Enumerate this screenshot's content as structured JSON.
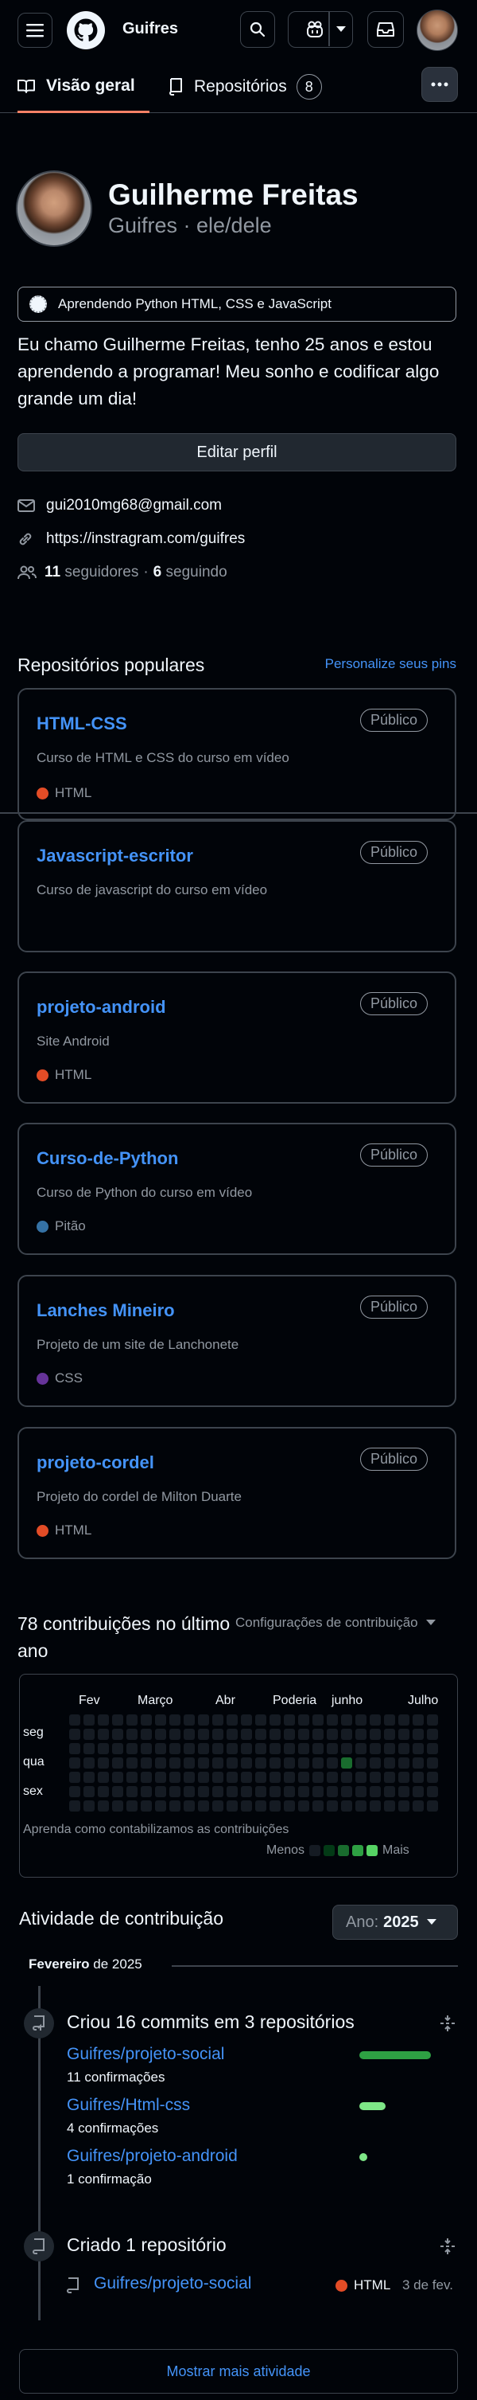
{
  "header": {
    "username": "Guifres"
  },
  "tabs": [
    {
      "label": "Visão geral"
    },
    {
      "label": "Repositórios",
      "count": "8"
    }
  ],
  "profile": {
    "full_name": "Guilherme Freitas",
    "login_line": "Guifres · ele/dele",
    "status": "Aprendendo Python HTML, CSS e JavaScript",
    "bio": "Eu chamo Guilherme Freitas, tenho 25 anos e estou aprendendo a programar! Meu sonho e codificar algo grande um dia!",
    "edit_button": "Editar perfil",
    "email": "gui2010mg68@gmail.com",
    "website": "https://instragram.com/guifres",
    "followers_count": "11",
    "followers_label": "seguidores",
    "separator": "·",
    "following_count": "6",
    "following_label": "seguindo"
  },
  "popular": {
    "title": "Repositórios populares",
    "customize_link": "Personalize seus pins",
    "repos": [
      {
        "name": "HTML-CSS",
        "visibility": "Público",
        "description": "Curso de HTML e CSS do curso em vídeo",
        "language": "HTML",
        "lang_color": "#e34c26"
      },
      {
        "name": "Javascript-escritor",
        "visibility": "Público",
        "description": "Curso de javascript do curso em vídeo",
        "language": "",
        "lang_color": ""
      },
      {
        "name": "projeto-android",
        "visibility": "Público",
        "description": "Site Android",
        "language": "HTML",
        "lang_color": "#e34c26"
      },
      {
        "name": "Curso-de-Python",
        "visibility": "Público",
        "description": "Curso de Python do curso em vídeo",
        "language": "Pitão",
        "lang_color": "#3572a5"
      },
      {
        "name": "Lanches Mineiro",
        "visibility": "Público",
        "description": "Projeto de um site de Lanchonete",
        "language": "CSS",
        "lang_color": "#663399"
      },
      {
        "name": "projeto-cordel",
        "visibility": "Público",
        "description": "Projeto do cordel de Milton Duarte",
        "language": "HTML",
        "lang_color": "#e34c26"
      }
    ]
  },
  "contributions": {
    "title": "78 contribuições no último ano",
    "settings": "Configurações de contribuição",
    "months": [
      "Fev",
      "Março",
      "Abr",
      "Poderia",
      "junho",
      "Julho"
    ],
    "days": [
      "seg",
      "qua",
      "sex"
    ],
    "learn": "Aprenda como contabilizamos as contribuições",
    "less": "Menos",
    "more": "Mais",
    "legend_colors": [
      "#151b23",
      "#033a16",
      "#196c2e",
      "#2ea043",
      "#56d364"
    ]
  },
  "activity": {
    "title": "Atividade de contribuição",
    "year_prefix": "Ano:",
    "year": "2025",
    "month_label": "Fevereiro",
    "month_year": "de 2025",
    "commits_title": "Criou 16 commits em 3 repositórios",
    "commit_repos": [
      {
        "name": "Guifres/projeto-social",
        "count": "11 confirmações",
        "share": 0.69
      },
      {
        "name": "Guifres/Html-css",
        "count": "4 confirmações",
        "share": 0.25
      },
      {
        "name": "Guifres/projeto-android",
        "count": "1 confirmação",
        "share": 0.06
      }
    ],
    "created_title": "Criado 1 repositório",
    "created_repo": {
      "name": "Guifres/projeto-social",
      "language": "HTML",
      "lang_color": "#e34c26",
      "date": "3 de fev."
    },
    "show_more": "Mostrar mais atividade"
  }
}
